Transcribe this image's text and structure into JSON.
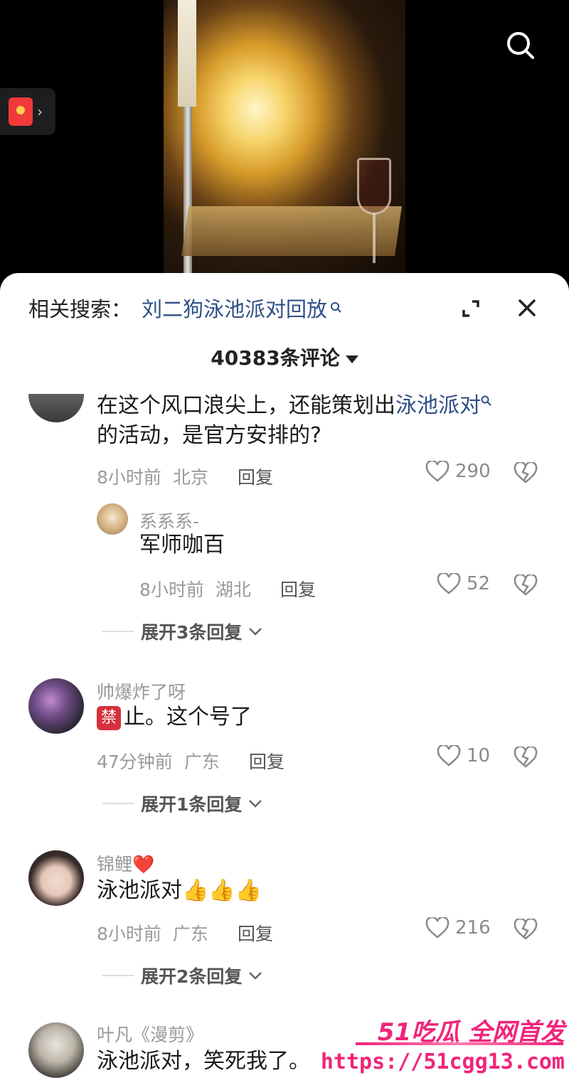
{
  "related_search": {
    "label": "相关搜索：",
    "keyword": "刘二狗泳池派对回放"
  },
  "comment_count": "40383条评论",
  "comments": [
    {
      "text_before": "在这个风口浪尖上，还能策划出",
      "text_highlight": "泳池派对",
      "text_line2": "的活动，是官方安排的?",
      "time": "8小时前",
      "location": "北京",
      "reply_label": "回复",
      "likes": "290"
    },
    {
      "username": "系系系-",
      "text": "军师咖百",
      "time": "8小时前",
      "location": "湖北",
      "reply_label": "回复",
      "likes": "52",
      "expand_label": "展开3条回复"
    },
    {
      "username": "帅爆炸了呀",
      "badge": "禁",
      "text": "止。这个号了",
      "time": "47分钟前",
      "location": "广东",
      "reply_label": "回复",
      "likes": "10",
      "expand_label": "展开1条回复"
    },
    {
      "username": "锦鲤❤️",
      "text": "泳池派对👍👍👍",
      "time": "8小时前",
      "location": "广东",
      "reply_label": "回复",
      "likes": "216",
      "expand_label": "展开2条回复"
    },
    {
      "username": "叶凡《漫剪》",
      "text": "泳池派对，笑死我了。"
    }
  ],
  "watermark": {
    "brand": "51吃瓜 全网首发",
    "url": "https://51cgg13.com"
  },
  "colors": {
    "link": "#2f4f86",
    "watermark": "#f0247a",
    "ban_badge": "#d6303e"
  }
}
